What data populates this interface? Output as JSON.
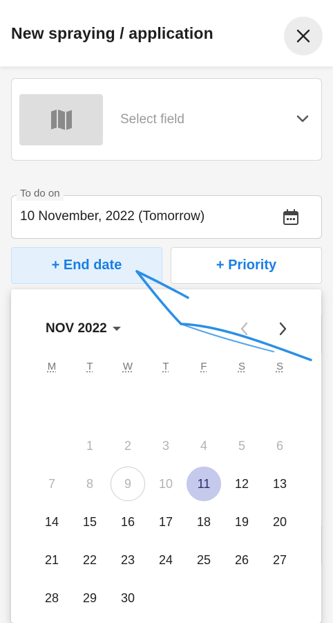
{
  "header": {
    "title": "New spraying / application",
    "close_icon": "close-icon"
  },
  "field_selector": {
    "placeholder": "Select field",
    "thumb_icon": "map-icon",
    "chevron_icon": "chevron-down-icon"
  },
  "todo": {
    "legend": "To do on",
    "value": "10 November, 2022 (Tomorrow)",
    "icon": "calendar-icon"
  },
  "buttons": {
    "end_date": "+ End date",
    "priority": "+ Priority"
  },
  "calendar": {
    "month_label": "NOV 2022",
    "weekdays": [
      "M",
      "T",
      "W",
      "T",
      "F",
      "S",
      "S"
    ],
    "rows": [
      [
        "",
        "1",
        "2",
        "3",
        "4",
        "5",
        "6"
      ],
      [
        "7",
        "8",
        "9",
        "10",
        "11",
        "12",
        "13"
      ],
      [
        "14",
        "15",
        "16",
        "17",
        "18",
        "19",
        "20"
      ],
      [
        "21",
        "22",
        "23",
        "24",
        "25",
        "26",
        "27"
      ],
      [
        "28",
        "29",
        "30",
        "",
        "",
        "",
        ""
      ]
    ],
    "muted_days": [
      "1",
      "2",
      "3",
      "4",
      "5",
      "6",
      "7",
      "8",
      "9",
      "10"
    ],
    "today": "9",
    "selected": "11",
    "prev_icon": "chevron-left-icon",
    "next_icon": "chevron-right-icon"
  },
  "colors": {
    "accent": "#1a7ee3",
    "selected_day": "#c5c9ec",
    "annotation_arrow": "#2a8fe6"
  }
}
